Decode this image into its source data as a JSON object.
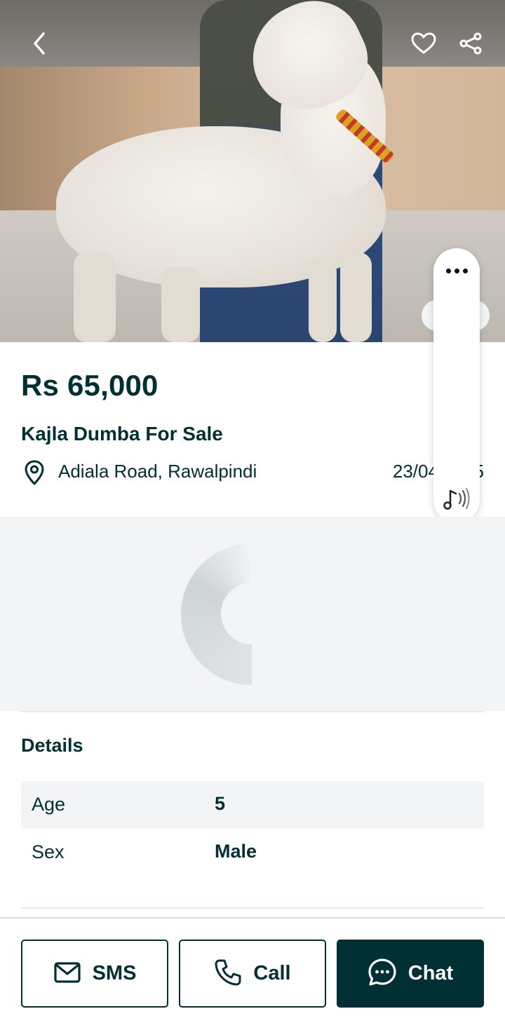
{
  "listing": {
    "price": "Rs 65,000",
    "title": "Kajla Dumba For Sale",
    "location": "Adiala Road, Rawalpindi",
    "date": "23/04/2025"
  },
  "icons": {
    "back": "chevron-left-icon",
    "favorite": "heart-icon",
    "share": "share-icon",
    "location": "map-pin-icon",
    "more": "more-dots-icon",
    "music": "music-sound-icon",
    "sms": "envelope-icon",
    "call": "phone-icon",
    "chat": "chat-bubble-icon"
  },
  "details": {
    "heading": "Details",
    "rows": [
      {
        "key": "Age",
        "value": "5"
      },
      {
        "key": "Sex",
        "value": "Male"
      }
    ]
  },
  "actions": {
    "sms_label": "SMS",
    "call_label": "Call",
    "chat_label": "Chat"
  },
  "colors": {
    "brand_dark": "#002f34",
    "surface_gray": "#f2f4f5",
    "white": "#ffffff"
  }
}
